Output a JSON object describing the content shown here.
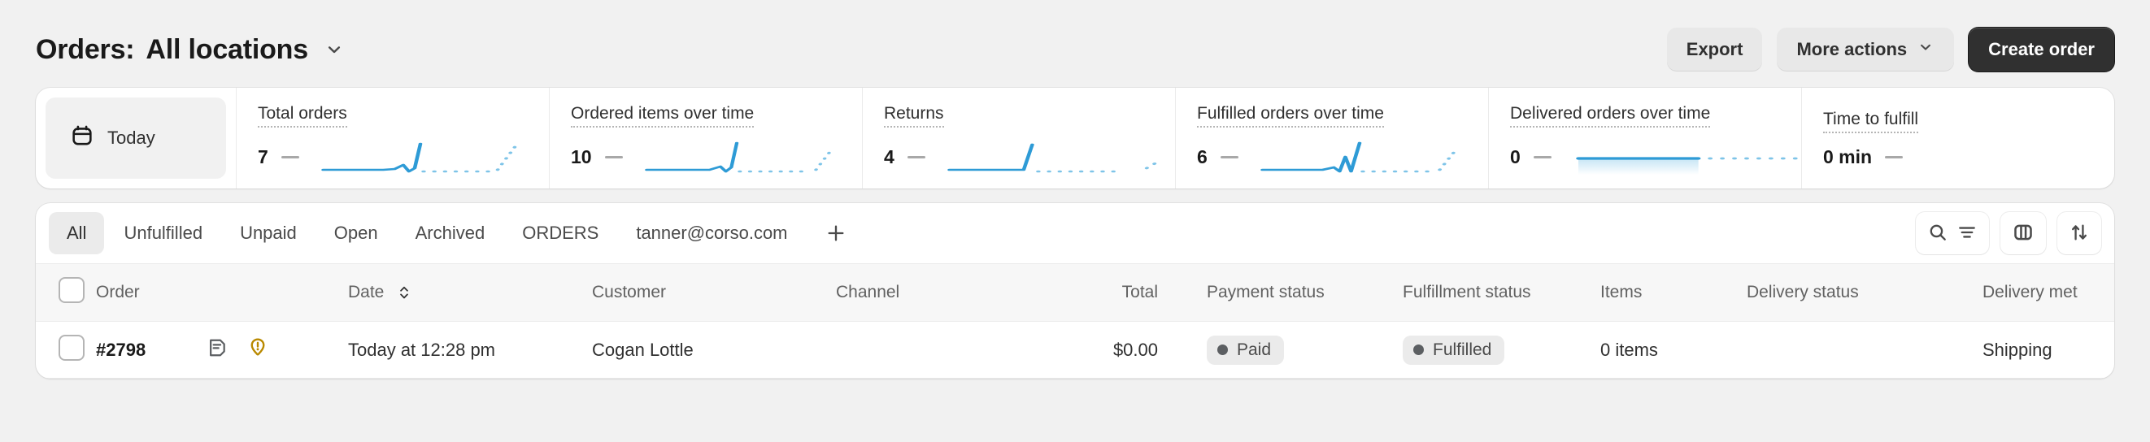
{
  "header": {
    "title_prefix": "Orders:",
    "title_scope": "All locations",
    "scope_chevron_icon": "chevron-down-icon",
    "actions": {
      "export_label": "Export",
      "more_actions_label": "More actions",
      "more_actions_chevron_icon": "chevron-down-icon",
      "create_order_label": "Create order"
    }
  },
  "metrics": {
    "date_range_label": "Today",
    "date_range_icon": "calendar-icon",
    "items": [
      {
        "label": "Total orders",
        "value": "7",
        "trend": "flat",
        "spark": "spike"
      },
      {
        "label": "Ordered items over time",
        "value": "10",
        "trend": "flat",
        "spark": "spike"
      },
      {
        "label": "Returns",
        "value": "4",
        "trend": "flat",
        "spark": "step"
      },
      {
        "label": "Fulfilled orders over time",
        "value": "6",
        "trend": "flat",
        "spark": "spike"
      },
      {
        "label": "Delivered orders over time",
        "value": "0",
        "trend": "flat",
        "spark": "zero"
      },
      {
        "label": "Time to fulfill",
        "value": "0 min",
        "trend": "flat",
        "spark": "none"
      }
    ]
  },
  "views": {
    "tabs": [
      {
        "label": "All",
        "active": true
      },
      {
        "label": "Unfulfilled",
        "active": false
      },
      {
        "label": "Unpaid",
        "active": false
      },
      {
        "label": "Open",
        "active": false
      },
      {
        "label": "Archived",
        "active": false
      },
      {
        "label": "ORDERS",
        "active": false
      },
      {
        "label": "tanner@corso.com",
        "active": false
      }
    ],
    "add_tab_icon": "plus-icon",
    "tools": [
      {
        "icon": "search-icon",
        "secondary_icon": "filter-icon"
      },
      {
        "icon": "columns-icon"
      },
      {
        "icon": "sort-icon"
      }
    ]
  },
  "table": {
    "select_all_icon": "checkbox-unchecked",
    "columns": [
      "Order",
      "Date",
      "Customer",
      "Channel",
      "Total",
      "Payment status",
      "Fulfillment status",
      "Items",
      "Delivery status",
      "Delivery met"
    ],
    "date_sort_icon": "sort-arrows-icon",
    "rows": [
      {
        "checkbox_icon": "checkbox-unchecked",
        "order": "#2798",
        "note_icon": "note-icon",
        "alert_icon": "alert-location-icon",
        "date": "Today at 12:28 pm",
        "customer": "Cogan Lottle",
        "channel": "",
        "total": "$0.00",
        "payment_status": "Paid",
        "fulfillment_status": "Fulfilled",
        "items": "0 items",
        "delivery_status": "",
        "delivery_method": "Shipping"
      }
    ]
  },
  "colors": {
    "accent_line": "#2E9BD6",
    "accent_line_dotted": "#7EC4E8",
    "primary_button_bg": "#303030",
    "alert_icon": "#B98900",
    "badge_bg": "#EBEBEB",
    "badge_dot": "#5C5F62",
    "page_bg": "#F1F1F1"
  }
}
